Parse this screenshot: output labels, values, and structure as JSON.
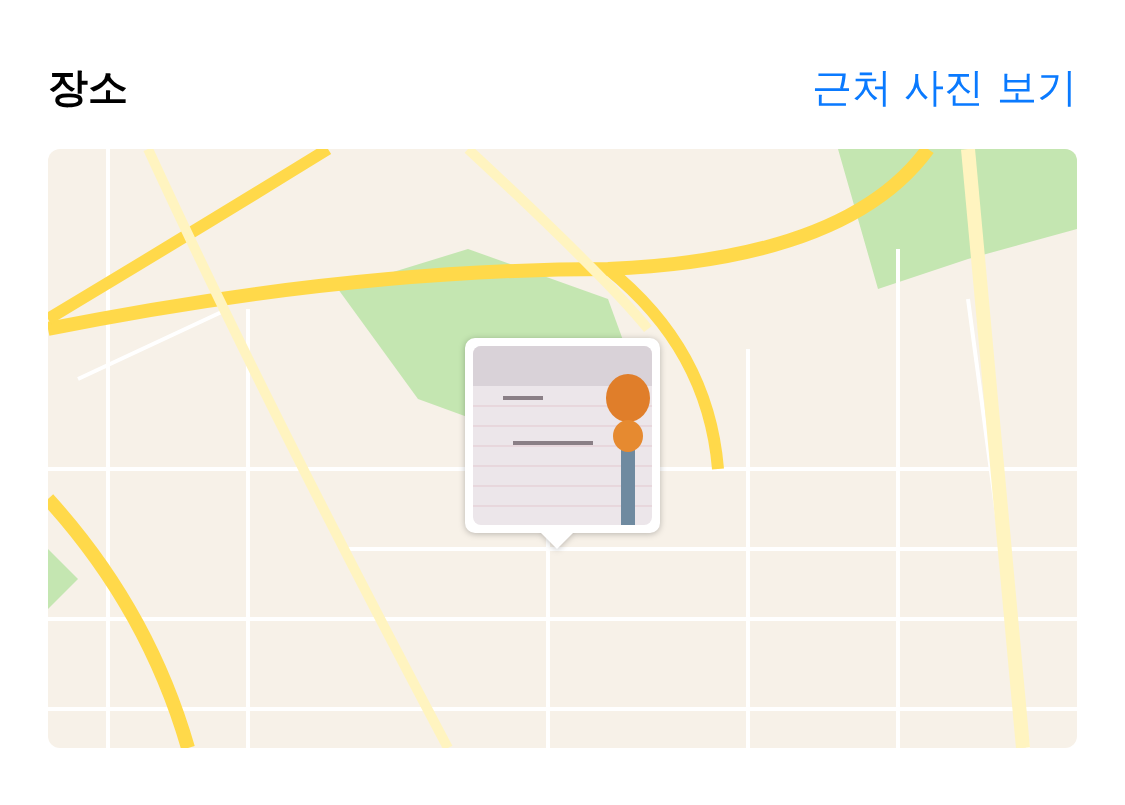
{
  "header": {
    "title": "장소",
    "link": "근처 사진 보기"
  },
  "map": {
    "kind": "picture"
  }
}
